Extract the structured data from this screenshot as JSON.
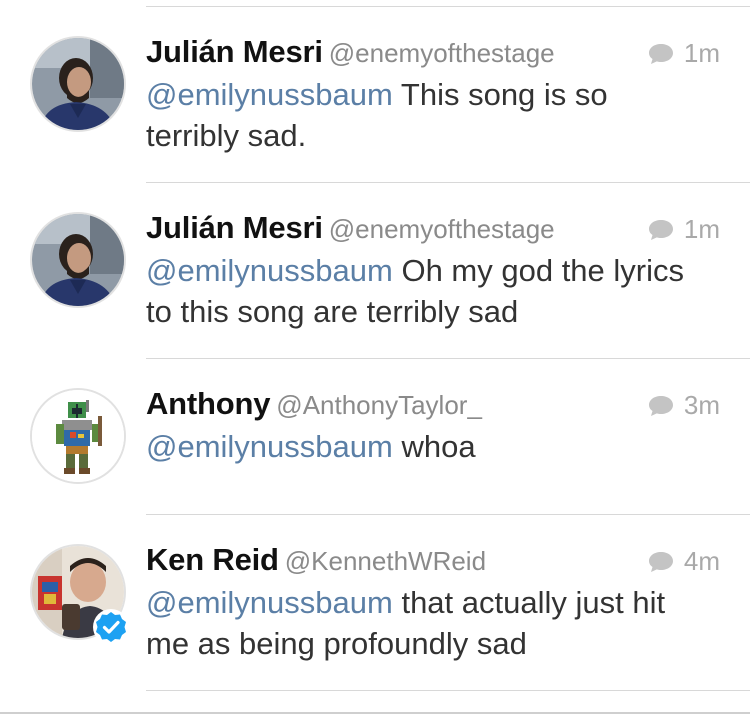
{
  "timeline": {
    "tweets": [
      {
        "name": "Julián Mesri",
        "handle": "@enemyofthestage",
        "time": "1m",
        "mention": "@emilynussbaum",
        "text": " This song is so terribly sad.",
        "avatar_icon": "portrait-photo",
        "verified": false
      },
      {
        "name": "Julián Mesri",
        "handle": "@enemyofthestage",
        "time": "1m",
        "mention": "@emilynussbaum",
        "text": " Oh my god the lyrics to this song are terribly sad",
        "avatar_icon": "portrait-photo",
        "verified": false
      },
      {
        "name": "Anthony",
        "handle": "@AnthonyTaylor_",
        "time": "3m",
        "mention": "@emilynussbaum",
        "text": " whoa",
        "avatar_icon": "pixel-art-bounty-hunter",
        "verified": false
      },
      {
        "name": "Ken Reid",
        "handle": "@KennethWReid",
        "time": "4m",
        "mention": "@emilynussbaum",
        "text": " that actually just hit me as being profoundly sad",
        "avatar_icon": "selfie-photo",
        "verified": true
      }
    ]
  },
  "colors": {
    "mention": "#5b7fa6",
    "meta_gray": "#a9a9a9",
    "verified_blue": "#1da1f2",
    "divider": "#d8d8d8"
  }
}
